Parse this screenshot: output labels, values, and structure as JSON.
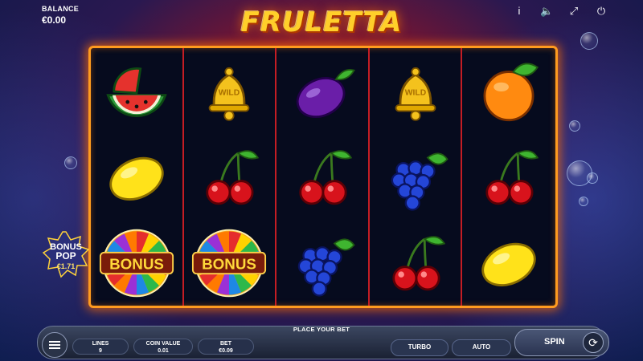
{
  "balance": {
    "label": "BALANCE",
    "value": "€0.00"
  },
  "top_icons": [
    "info-icon",
    "sound-icon",
    "fullscreen-icon",
    "power-icon"
  ],
  "top_icon_glyphs": {
    "info": "i",
    "sound": "🔈",
    "fullscreen": "⤢",
    "power": "⏻"
  },
  "logo": "FRULETTA",
  "reels": [
    [
      "watermelon",
      "lemon",
      "bonus"
    ],
    [
      "bell",
      "cherry",
      "bonus"
    ],
    [
      "plum",
      "cherry",
      "grapes"
    ],
    [
      "bell",
      "grapes",
      "cherry"
    ],
    [
      "orange",
      "cherry",
      "lemon"
    ]
  ],
  "symbols": {
    "bell_text": "WILD",
    "bonus_text": "BONUS"
  },
  "bonus_pop": {
    "line1": "BONUS",
    "line2": "POP",
    "amount": "€1.71"
  },
  "controls": {
    "place_bet": "PLACE YOUR BET",
    "lines": {
      "label": "LINES",
      "value": "9"
    },
    "coin_value": {
      "label": "COIN VALUE",
      "value": "0.01"
    },
    "bet": {
      "label": "BET",
      "value": "€0.09"
    },
    "turbo": "TURBO",
    "auto": "AUTO",
    "spin": "SPIN"
  },
  "colors": {
    "frame": "#ff9b1f",
    "reel_divider": "#c41d24",
    "logo": "#ffcf2a"
  }
}
